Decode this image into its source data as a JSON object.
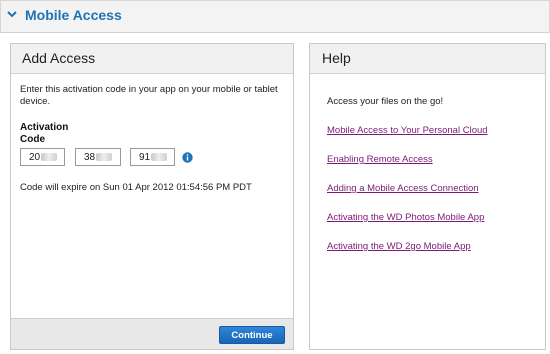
{
  "header": {
    "title": "Mobile Access"
  },
  "add_access": {
    "title": "Add Access",
    "instructions": "Enter this activation code in your app on your mobile or tablet device.",
    "code_label_line1": "Activation",
    "code_label_line2": "Code",
    "code_parts": [
      "20",
      "38",
      "91"
    ],
    "expiry_text": "Code will expire on Sun 01 Apr 2012 01:54:56 PM PDT",
    "continue_label": "Continue"
  },
  "help": {
    "title": "Help",
    "intro": "Access your files on the go!",
    "links": [
      "Mobile Access to Your Personal Cloud",
      "Enabling Remote Access",
      "Adding a Mobile Access Connection",
      "Activating the WD Photos Mobile App",
      "Activating the WD 2go Mobile App"
    ]
  },
  "colors": {
    "accent": "#1f73b7",
    "link_visited": "#7b1a78",
    "button": "#1a64b6"
  },
  "icons": {
    "header_toggle": "chevron-down-icon",
    "code_info": "info-icon"
  }
}
